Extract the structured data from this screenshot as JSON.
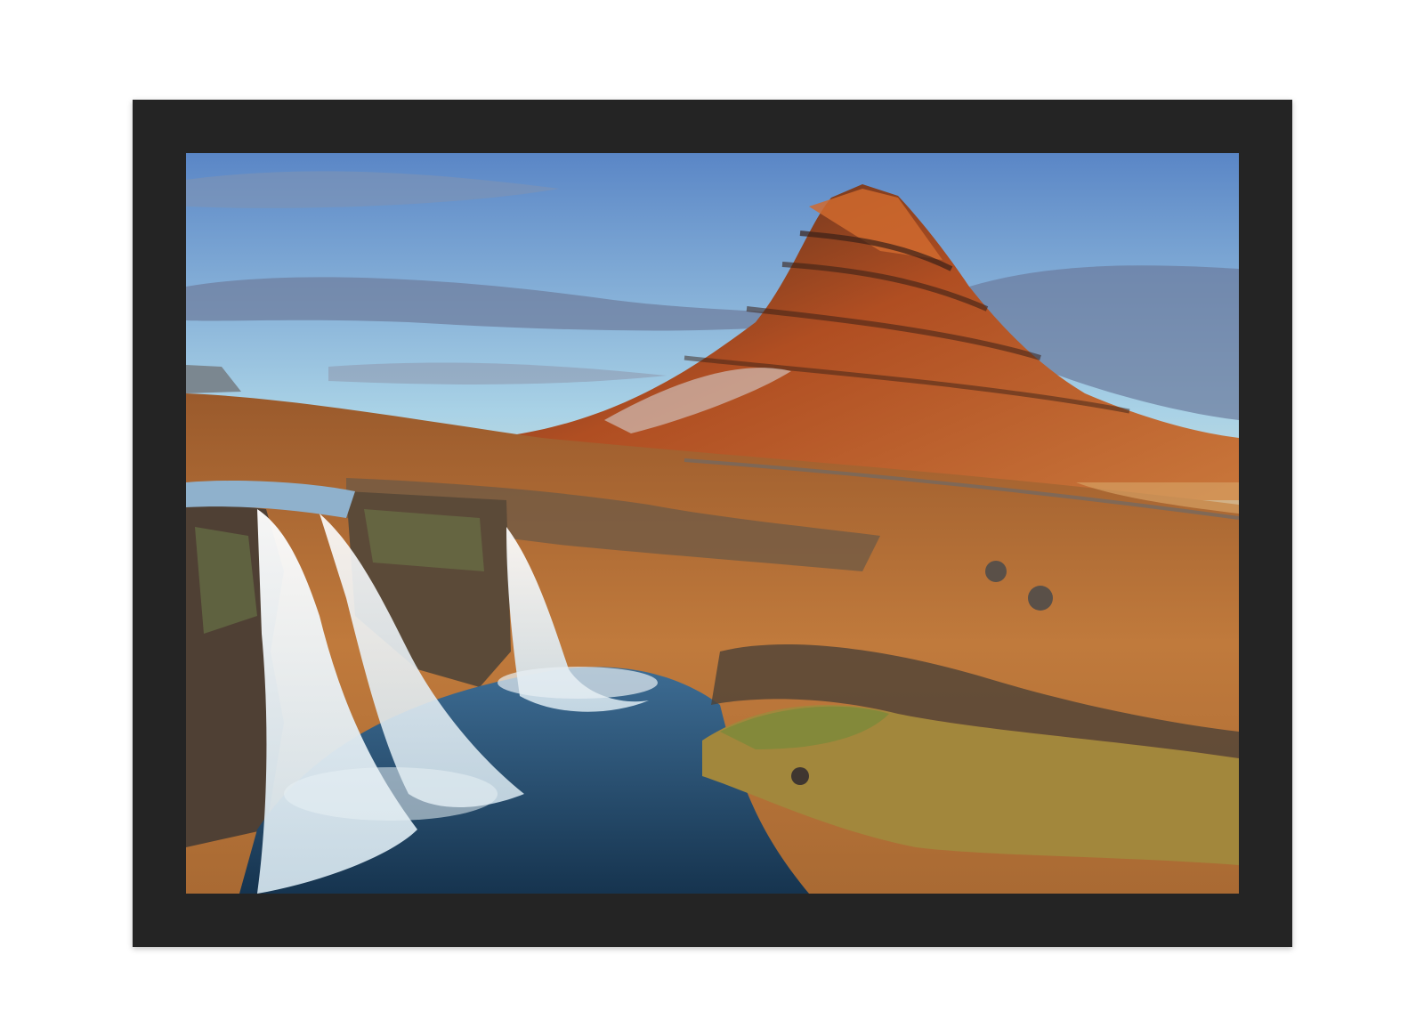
{
  "scene": {
    "frame_color": "#242424",
    "background_color": "#ffffff",
    "sky_top_color": "#5f8fcf",
    "sky_horizon_color": "#f3eedc",
    "mountain_color": "#8b3e1c",
    "mountain_lit_color": "#d2692c",
    "grass_color": "#b8743a",
    "water_color": "#1f4468",
    "falls_color": "#eef4f8"
  }
}
